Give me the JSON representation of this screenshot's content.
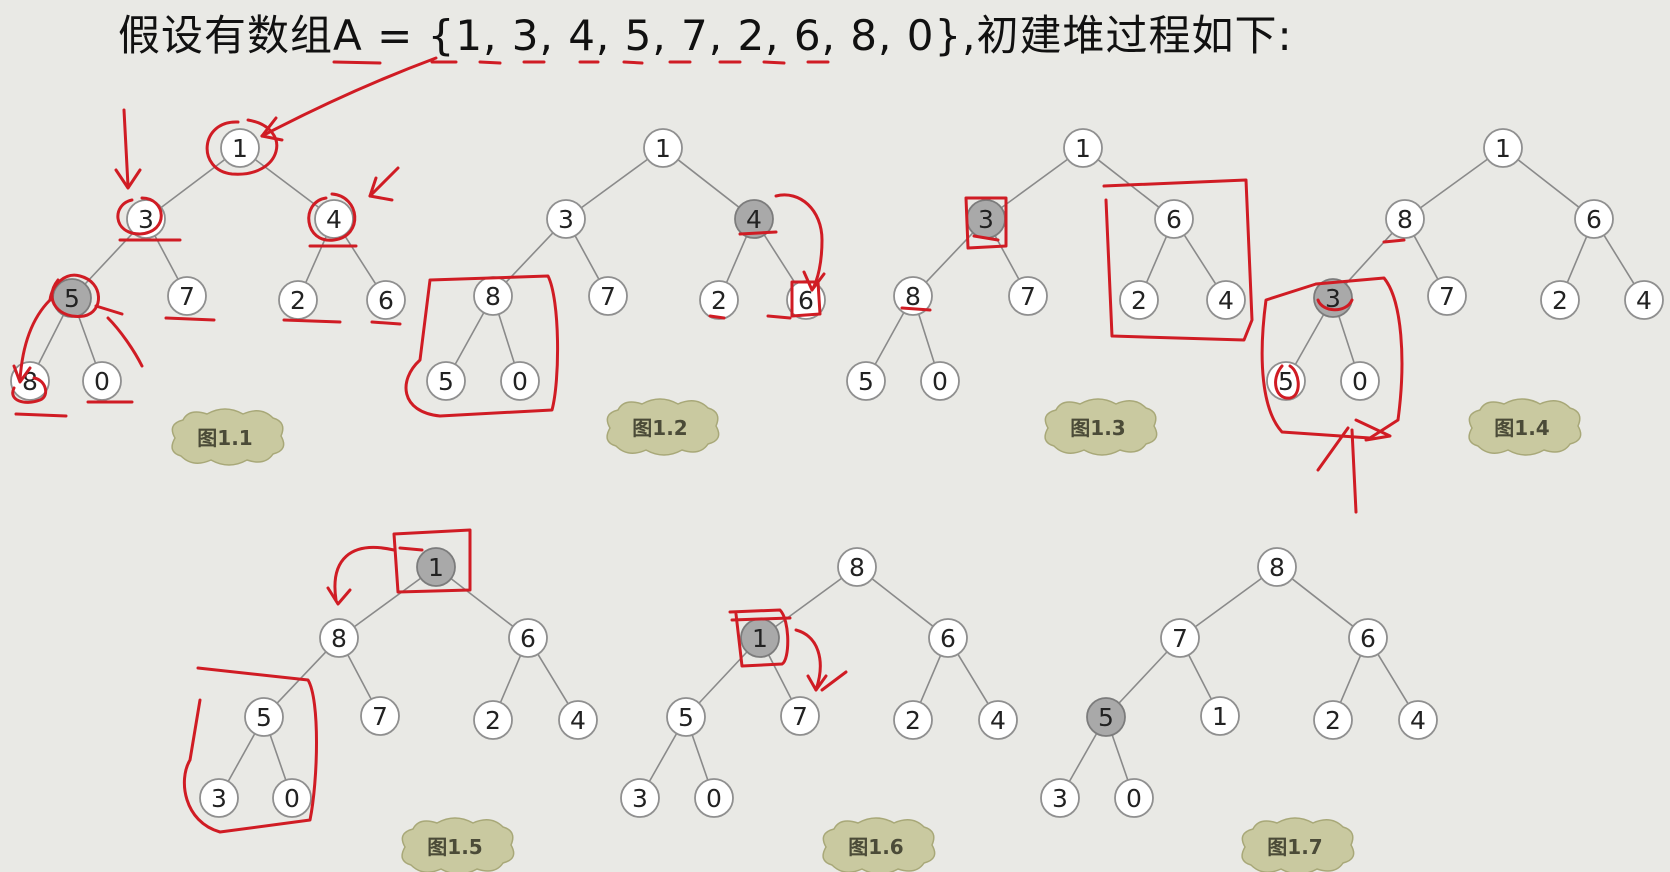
{
  "title": "假设有数组A = {1, 3, 4, 5, 7, 2, 6, 8, 0},初建堆过程如下:",
  "colors": {
    "annotation": "#d01c24",
    "highlight_node": "#a9a9a9",
    "caption_cloud": "#c9c9a0"
  },
  "figures": [
    {
      "caption": "图1.1",
      "values": [
        "1",
        "3",
        "4",
        "5",
        "7",
        "2",
        "6",
        "8",
        "0"
      ],
      "highlighted": [
        3
      ]
    },
    {
      "caption": "图1.2",
      "values": [
        "1",
        "3",
        "4",
        "8",
        "7",
        "2",
        "6",
        "5",
        "0"
      ],
      "highlighted": [
        2
      ]
    },
    {
      "caption": "图1.3",
      "values": [
        "1",
        "3",
        "6",
        "8",
        "7",
        "2",
        "4",
        "5",
        "0"
      ],
      "highlighted": [
        1
      ]
    },
    {
      "caption": "图1.4",
      "values": [
        "1",
        "8",
        "6",
        "3",
        "7",
        "2",
        "4",
        "5",
        "0"
      ],
      "highlighted": [
        3
      ]
    },
    {
      "caption": "图1.5",
      "values": [
        "1",
        "8",
        "6",
        "5",
        "7",
        "2",
        "4",
        "3",
        "0"
      ],
      "highlighted": [
        0
      ]
    },
    {
      "caption": "图1.6",
      "values": [
        "8",
        "1",
        "6",
        "5",
        "7",
        "2",
        "4",
        "3",
        "0"
      ],
      "highlighted": [
        1
      ]
    },
    {
      "caption": "图1.7",
      "values": [
        "8",
        "7",
        "6",
        "5",
        "1",
        "2",
        "4",
        "3",
        "0"
      ],
      "highlighted": [
        3
      ]
    }
  ]
}
